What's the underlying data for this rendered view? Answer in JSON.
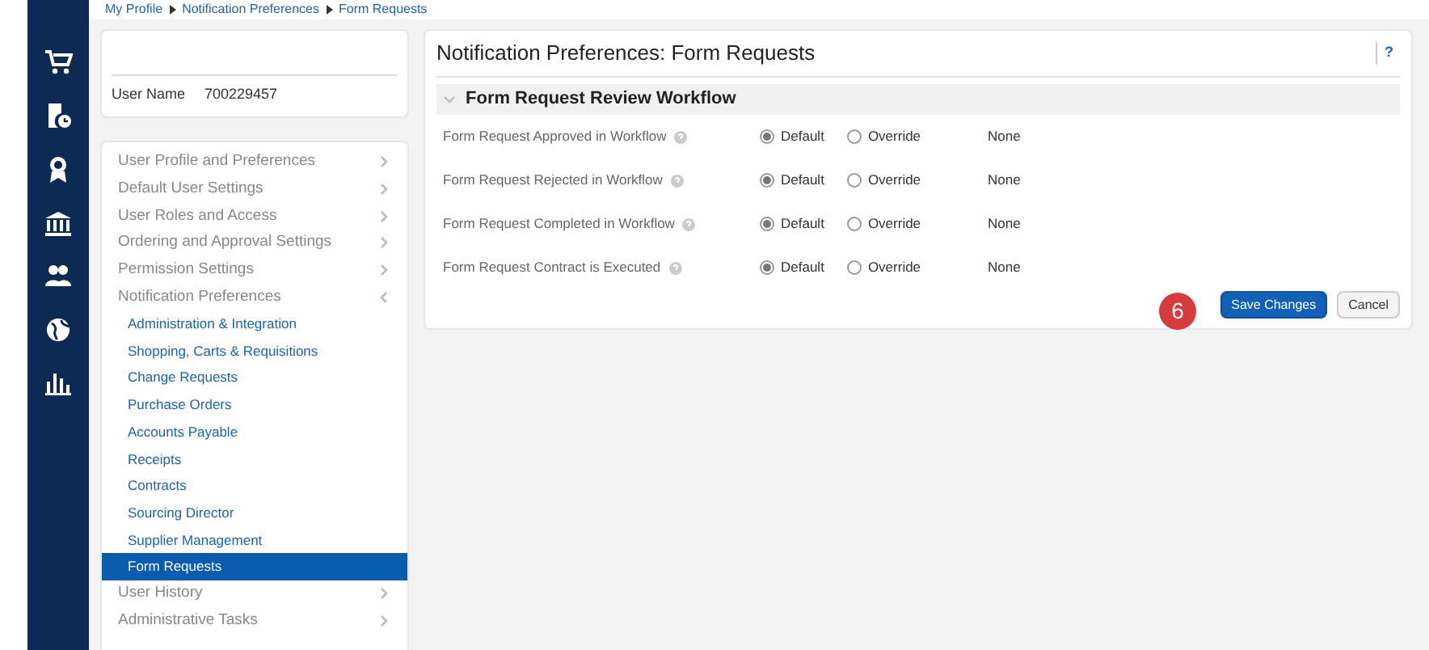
{
  "breadcrumb": [
    "My Profile",
    "Notification Preferences",
    "Form Requests"
  ],
  "user_card": {
    "label": "User Name",
    "value": "700229457"
  },
  "nav": [
    {
      "label": "User Profile and Preferences",
      "kind": "section",
      "expanded": false
    },
    {
      "label": "Default User Settings",
      "kind": "section",
      "expanded": false
    },
    {
      "label": "User Roles and Access",
      "kind": "section",
      "expanded": false
    },
    {
      "label": "Ordering and Approval Settings",
      "kind": "section",
      "expanded": false
    },
    {
      "label": "Permission Settings",
      "kind": "section",
      "expanded": false
    },
    {
      "label": "Notification Preferences",
      "kind": "section",
      "expanded": true,
      "children": [
        {
          "label": "Administration & Integration",
          "selected": false
        },
        {
          "label": "Shopping, Carts & Requisitions",
          "selected": false
        },
        {
          "label": "Change Requests",
          "selected": false
        },
        {
          "label": "Purchase Orders",
          "selected": false
        },
        {
          "label": "Accounts Payable",
          "selected": false
        },
        {
          "label": "Receipts",
          "selected": false
        },
        {
          "label": "Contracts",
          "selected": false
        },
        {
          "label": "Sourcing Director",
          "selected": false
        },
        {
          "label": "Supplier Management",
          "selected": false
        },
        {
          "label": "Form Requests",
          "selected": true
        }
      ]
    },
    {
      "label": "User History",
      "kind": "section",
      "expanded": false
    },
    {
      "label": "Administrative Tasks",
      "kind": "section",
      "expanded": false
    }
  ],
  "panel": {
    "title": "Notification Preferences:  Form Requests",
    "help": "?",
    "section": {
      "title": "Form Request Review Workflow",
      "expanded": true,
      "rows": [
        {
          "label": "Form Request Approved in Workflow",
          "options": [
            {
              "label": "Default",
              "selected": true
            },
            {
              "label": "Override",
              "selected": false
            }
          ],
          "value": "None"
        },
        {
          "label": "Form Request Rejected in Workflow",
          "options": [
            {
              "label": "Default",
              "selected": true
            },
            {
              "label": "Override",
              "selected": false
            }
          ],
          "value": "None"
        },
        {
          "label": "Form Request Completed in Workflow",
          "options": [
            {
              "label": "Default",
              "selected": true
            },
            {
              "label": "Override",
              "selected": false
            }
          ],
          "value": "None"
        },
        {
          "label": "Form Request Contract is Executed",
          "options": [
            {
              "label": "Default",
              "selected": true
            },
            {
              "label": "Override",
              "selected": false
            }
          ],
          "value": "None"
        }
      ]
    },
    "step_badge": "6",
    "buttons": [
      {
        "label": "Save Changes",
        "kind": "primary"
      },
      {
        "label": "Cancel",
        "kind": "secondary"
      }
    ]
  }
}
